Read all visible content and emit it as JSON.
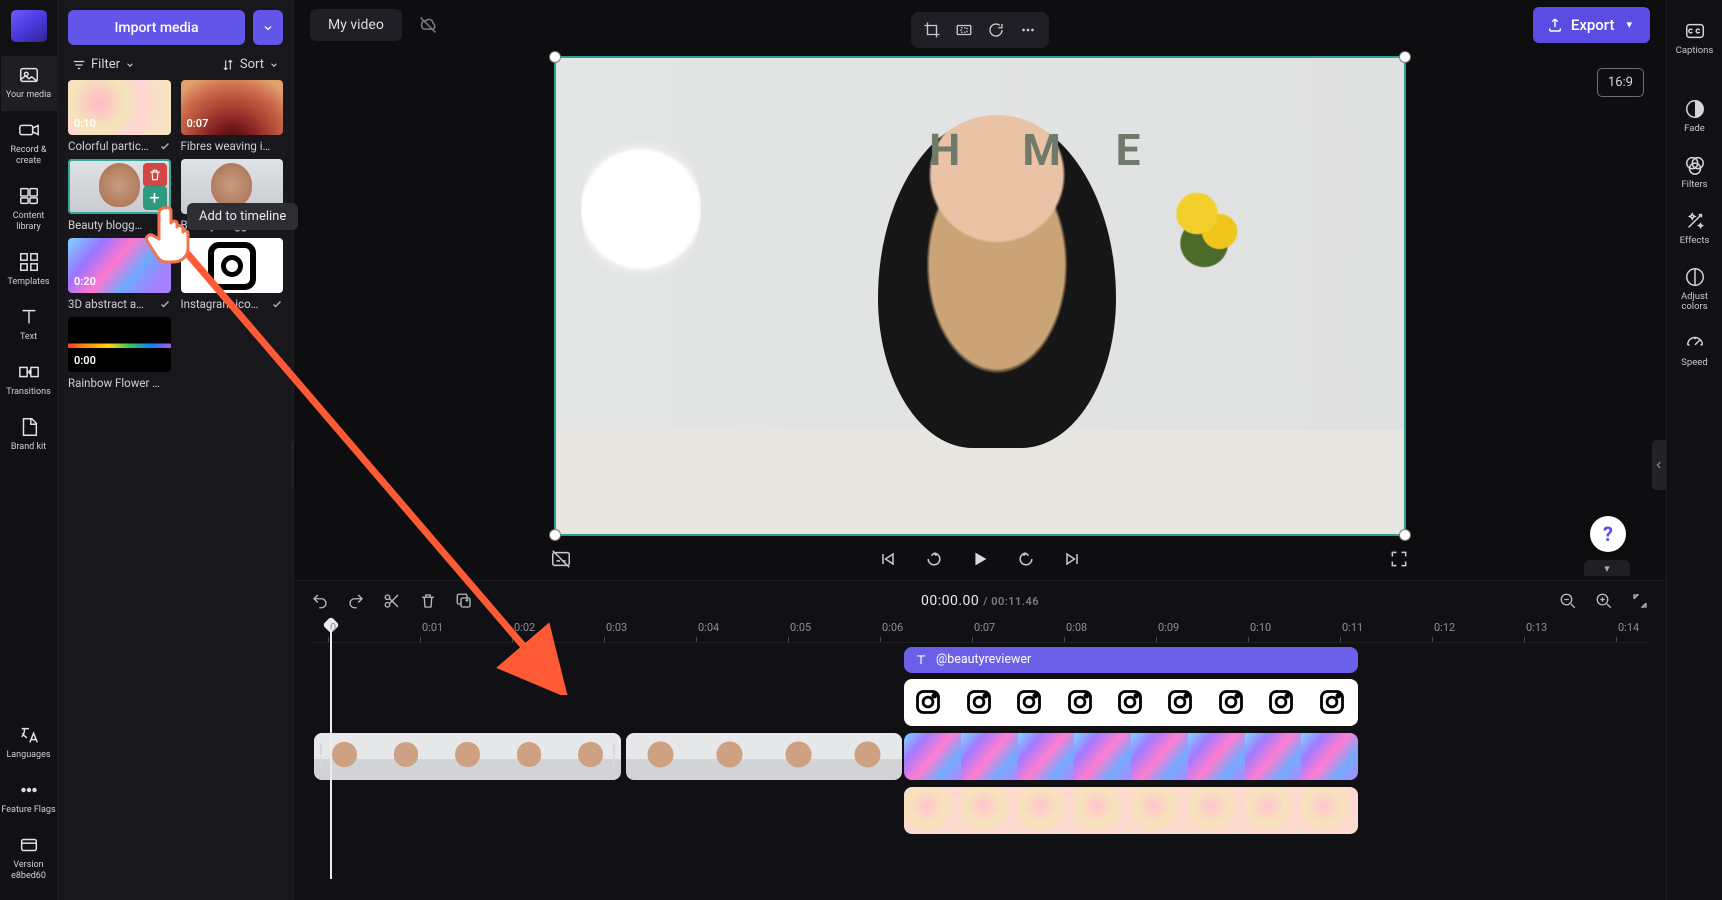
{
  "header": {
    "import_label": "Import media",
    "video_title": "My video",
    "export_label": "Export",
    "aspect_label": "16:9"
  },
  "filter_bar": {
    "filter": "Filter",
    "sort": "Sort"
  },
  "tooltip": {
    "add_to_timeline": "Add to timeline"
  },
  "left_rail": {
    "your_media": "Your media",
    "record": "Record & create",
    "content": "Content library",
    "templates": "Templates",
    "text": "Text",
    "transitions": "Transitions",
    "brand": "Brand kit",
    "languages": "Languages",
    "flags": "Feature Flags",
    "version_label": "Version",
    "version_value": "e8bed60"
  },
  "right_rail": {
    "captions": "Captions",
    "fade": "Fade",
    "filters": "Filters",
    "effects": "Effects",
    "adjust": "Adjust colors",
    "speed": "Speed"
  },
  "clips": [
    {
      "name": "Colorful partic…",
      "dur": "0:10"
    },
    {
      "name": "Fibres weaving i…",
      "dur": "0:07"
    },
    {
      "name": "Beauty blogg…",
      "dur": ""
    },
    {
      "name": "Beauty blogg…",
      "dur": ""
    },
    {
      "name": "3D abstract a…",
      "dur": "0:20"
    },
    {
      "name": "Instagram ico…",
      "dur": ""
    },
    {
      "name": "Rainbow Flower …",
      "dur": "0:00"
    }
  ],
  "timeline": {
    "current": "00:00.00",
    "total": "00:11.46",
    "text_track_label": "@beautyreviewer",
    "ticks": [
      "0",
      "0:01",
      "0:02",
      "0:03",
      "0:04",
      "0:05",
      "0:06",
      "0:07",
      "0:08",
      "0:09",
      "0:10",
      "0:11",
      "0:12",
      "0:13",
      "0:14"
    ]
  }
}
